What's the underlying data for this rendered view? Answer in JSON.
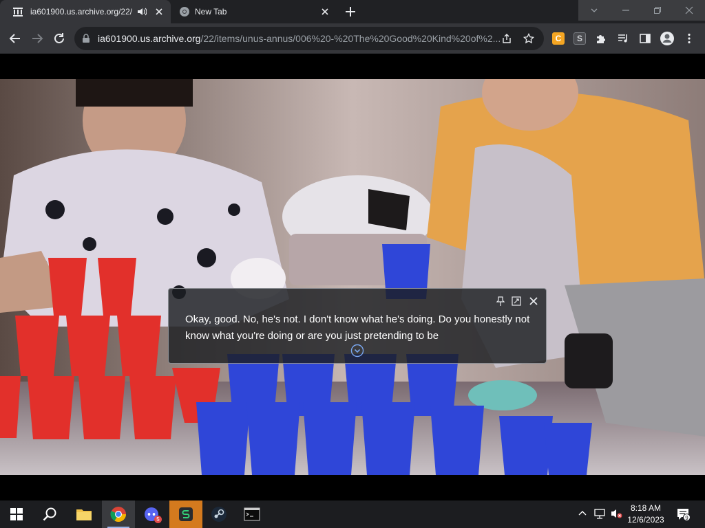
{
  "browser": {
    "tabs": [
      {
        "title": "ia601900.us.archive.org/22/i",
        "active": true,
        "audio": true
      },
      {
        "title": "New Tab",
        "active": false
      }
    ],
    "url": {
      "host": "ia601900.us.archive.org",
      "path": "/22/items/unus-annus/006%20-%20The%20Good%20Kind%20of%2..."
    },
    "extensions": [
      "C",
      "S"
    ]
  },
  "captions": {
    "text": "Okay, good. No, he's not. I don't know what he's doing. Do you honestly not know what you're doing or are you just pretending to be"
  },
  "taskbar": {
    "apps": [
      "windows-start",
      "search",
      "file-explorer",
      "chrome",
      "discord",
      "extension-app",
      "steam",
      "terminal"
    ],
    "discord_badge": "5",
    "time": "8:18 AM",
    "date": "12/6/2023",
    "notifications_count": "9"
  },
  "colors": {
    "tabstrip": "#202124",
    "toolbar": "#35363a",
    "accent": "#9ab4e8"
  }
}
